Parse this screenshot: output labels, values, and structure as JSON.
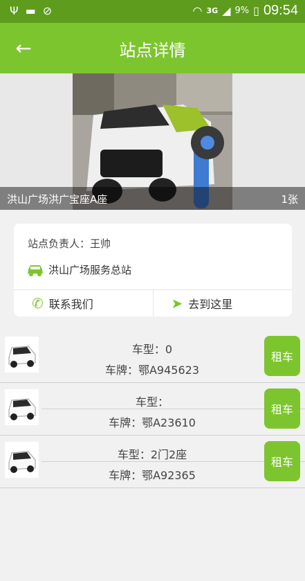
{
  "status_bar": {
    "icons_left": [
      "usb-icon",
      "download-icon",
      "blocked-icon"
    ],
    "network": "3G",
    "battery_percent": "9%",
    "time": "09:54"
  },
  "app_bar": {
    "title": "站点详情"
  },
  "hero": {
    "station_name": "洪山广场洪广宝座A座",
    "photo_count": "1张"
  },
  "info_card": {
    "manager": "站点负责人：王帅",
    "station": "洪山广场服务总站",
    "contact_label": "联系我们",
    "navigate_label": "去到这里"
  },
  "cars": [
    {
      "model": "车型：0",
      "plate": "车牌：鄂A945623",
      "rent_label": "租车"
    },
    {
      "model": "车型：",
      "plate": "车牌：鄂A23610",
      "rent_label": "租车"
    },
    {
      "model": "车型：2门2座",
      "plate": "车牌：鄂A92365",
      "rent_label": "租车"
    }
  ],
  "colors": {
    "status_bar": "#5e9c1e",
    "accent": "#7dc52e",
    "background": "#f1f1f1"
  }
}
